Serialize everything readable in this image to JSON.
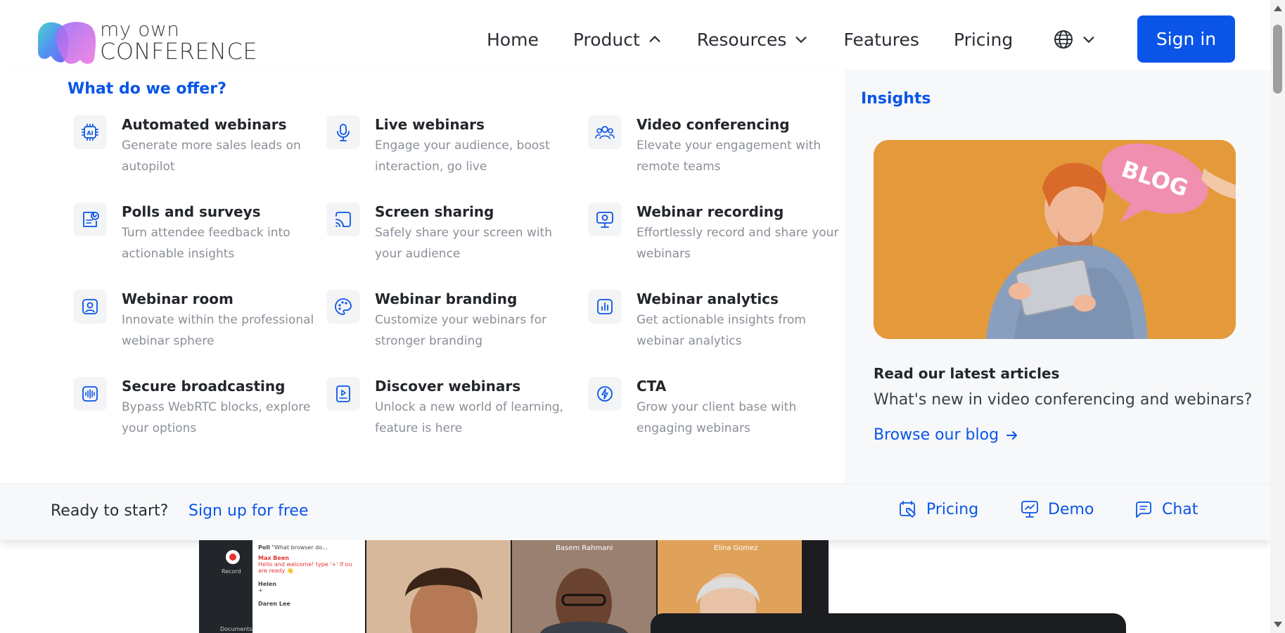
{
  "logo": {
    "line1": "my own",
    "line2": "CONFERENCE"
  },
  "nav": {
    "home": "Home",
    "product": "Product",
    "resources": "Resources",
    "features": "Features",
    "pricing": "Pricing"
  },
  "signin": "Sign in",
  "dropdown": {
    "title": "What do we offer?",
    "items": [
      {
        "title": "Automated webinars",
        "desc": "Generate more sales leads on autopilot",
        "icon": "ai-chip-icon"
      },
      {
        "title": "Live webinars",
        "desc": "Engage your audience, boost interaction, go live",
        "icon": "microphone-icon"
      },
      {
        "title": "Video conferencing",
        "desc": "Elevate your engagement with remote teams",
        "icon": "group-icon"
      },
      {
        "title": "Polls and surveys",
        "desc": "Turn attendee feedback into actionable insights",
        "icon": "poll-icon"
      },
      {
        "title": "Screen sharing",
        "desc": "Safely share your screen with your audience",
        "icon": "cast-icon"
      },
      {
        "title": "Webinar recording",
        "desc": "Effortlessly record and share your webinars",
        "icon": "record-monitor-icon"
      },
      {
        "title": "Webinar room",
        "desc": "Innovate within the professional webinar sphere",
        "icon": "user-frame-icon"
      },
      {
        "title": "Webinar branding",
        "desc": "Customize your webinars for stronger branding",
        "icon": "palette-icon"
      },
      {
        "title": "Webinar analytics",
        "desc": "Get actionable insights from webinar analytics",
        "icon": "analytics-icon"
      },
      {
        "title": "Secure broadcasting",
        "desc": "Bypass WebRTC blocks, explore your options",
        "icon": "broadcast-icon"
      },
      {
        "title": "Discover webinars",
        "desc": "Unlock a new world of learning, feature is here",
        "icon": "play-card-icon"
      },
      {
        "title": "CTA",
        "desc": "Grow your client base with engaging webinars",
        "icon": "lightning-icon"
      }
    ]
  },
  "insights": {
    "title": "Insights",
    "bubble_text": "BLOG",
    "read_title": "Read our latest articles",
    "read_sub": "What's new in video conferencing and webinars?",
    "browse": "Browse our blog"
  },
  "bottom": {
    "ready": "Ready to start?",
    "signup": "Sign up for free",
    "pricing": "Pricing",
    "demo": "Demo",
    "chat": "Chat"
  },
  "preview": {
    "record_label": "Record",
    "documents_label": "Documents",
    "poll_label": "Poll",
    "poll_question": "\"What browser do...",
    "chat": [
      {
        "name": "Max Been",
        "text": "Hello and welcome! type '+' if ou are ready 👋"
      },
      {
        "name": "Helen",
        "text": "+"
      },
      {
        "name": "Daren Lee",
        "text": ""
      }
    ],
    "name_1": "Basem Rahmani",
    "name_2": "Elina Gomez"
  },
  "colors": {
    "accent": "#0a55e8",
    "panel": "#f7f8fa"
  }
}
